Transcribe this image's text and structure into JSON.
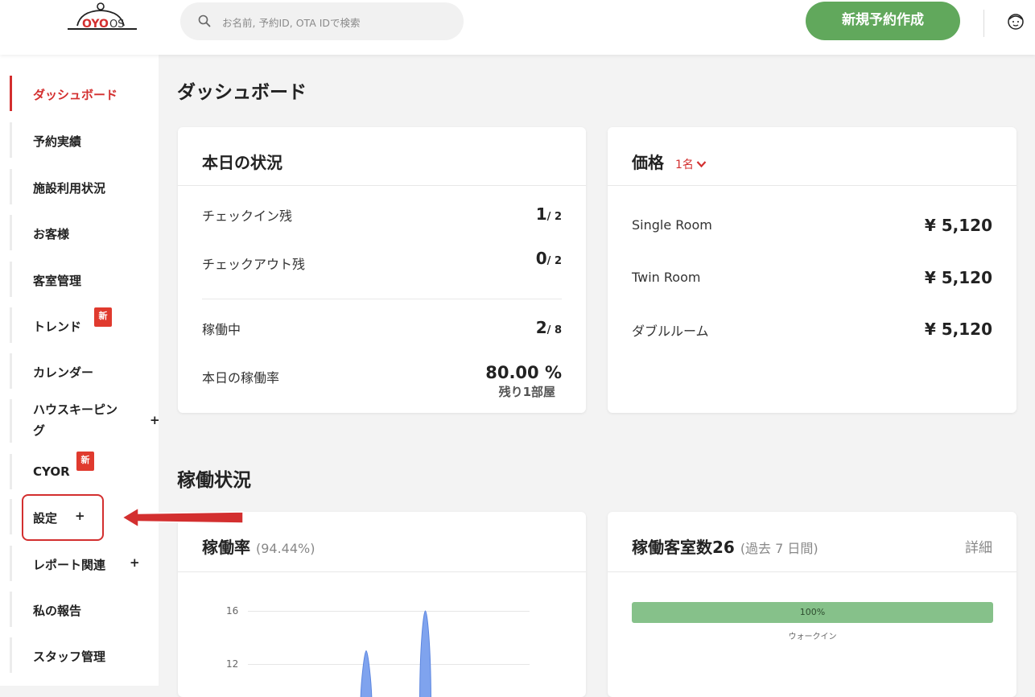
{
  "header": {
    "logo_brand": "OYO",
    "logo_suffix": "OS",
    "search_placeholder": "お名前, 予約ID, OTA IDで検索",
    "new_booking_label": "新規予約作成"
  },
  "sidebar": {
    "items": [
      {
        "label": "ダッシュボード",
        "active": true
      },
      {
        "label": "予約実績"
      },
      {
        "label": "施設利用状況"
      },
      {
        "label": "お客様"
      },
      {
        "label": "客室管理"
      },
      {
        "label": "トレンド",
        "badge": "新"
      },
      {
        "label": "カレンダー"
      },
      {
        "label": "ハウスキーピング",
        "line1": "ハウスキーピン",
        "line2": "グ",
        "plus": "+"
      },
      {
        "label": "CYOR",
        "badge": "新"
      },
      {
        "label": "設定",
        "plus": "+"
      },
      {
        "label": "レポート関連",
        "plus": "+"
      },
      {
        "label": "私の報告"
      },
      {
        "label": "スタッフ管理"
      }
    ]
  },
  "main": {
    "page_title": "ダッシュボード",
    "today_card": {
      "title": "本日の状況",
      "rows": [
        {
          "label": "チェックイン残",
          "value": "1",
          "denominator": "/ 2"
        },
        {
          "label": "チェックアウト残",
          "value": "0",
          "denominator": "/ 2"
        },
        {
          "label": "稼働中",
          "value": "2",
          "denominator": "/ 8"
        },
        {
          "label": "本日の稼働率",
          "value": "80.00 %",
          "sub": "残り1部屋"
        }
      ]
    },
    "price_card": {
      "title": "価格",
      "selector": "1名",
      "rows": [
        {
          "label": "Single Room",
          "value": "¥ 5,120"
        },
        {
          "label": "Twin Room",
          "value": "¥ 5,120"
        },
        {
          "label": "ダブルルーム",
          "value": "¥ 5,120"
        }
      ]
    },
    "occupancy_title": "稼働状況",
    "occupancy_rate_card": {
      "title": "稼働率",
      "subtitle": "(94.44%)"
    },
    "occupied_rooms_card": {
      "title": "稼働客室数26",
      "subtitle": "(過去 7 日間)",
      "detail_link": "詳細",
      "progress_percent": 100,
      "progress_label": "100%",
      "progress_caption": "ウォークイン"
    }
  },
  "chart_data": {
    "type": "area",
    "y_ticks": [
      "16",
      "12"
    ],
    "ylim": [
      0,
      16
    ],
    "peaks": [
      {
        "position": 0.42,
        "value": 13
      },
      {
        "position": 0.63,
        "value": 16
      }
    ],
    "color": "#7fa3ee"
  },
  "colors": {
    "brand_red": "#d32f2f",
    "primary_green": "#61a85c",
    "progress_green": "#86c18a"
  }
}
